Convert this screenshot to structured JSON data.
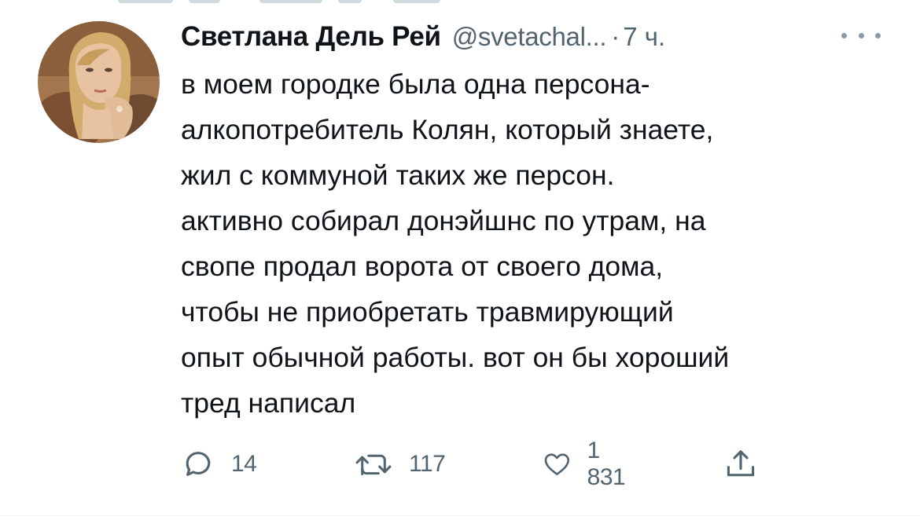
{
  "author": {
    "name": "Светлана Дель Рей",
    "handle": "@svetachal...",
    "separator": "·",
    "time": "7 ч."
  },
  "tweet": {
    "lines": [
      "в моем городке была одна персона-",
      "алкопотребитель Колян, который знаете,",
      "жил с коммуной таких же персон.",
      "активно собирал донэйшнс по утрам, на",
      "свопе продал ворота от своего дома,",
      "чтобы не приобретать травмирующий",
      "опыт обычной работы. вот он бы хороший",
      "тред написал"
    ]
  },
  "actions": {
    "reply_count": "14",
    "retweet_count": "117",
    "like_count": "1 831"
  },
  "icons": {
    "reply": "reply-icon",
    "retweet": "retweet-icon",
    "like": "heart-icon",
    "share": "share-icon",
    "more": "more-icon"
  },
  "colors": {
    "text_primary": "#0f1419",
    "text_secondary": "#536471",
    "divider": "#eff3f4"
  }
}
